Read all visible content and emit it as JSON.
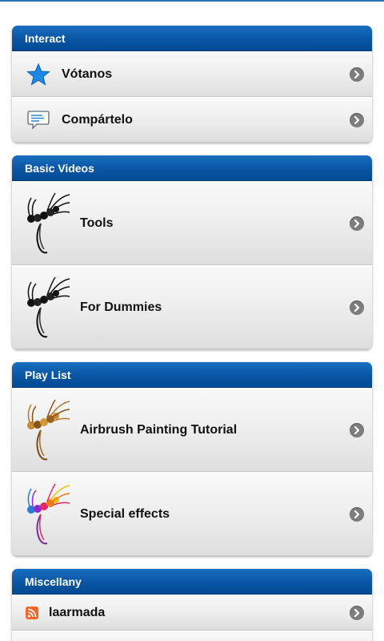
{
  "sections": {
    "interact": {
      "title": "Interact",
      "items": [
        {
          "label": "Vótanos",
          "icon": "star-icon"
        },
        {
          "label": "Compártelo",
          "icon": "speech-bubble-icon"
        }
      ]
    },
    "basic_videos": {
      "title": "Basic Videos",
      "items": [
        {
          "label": "Tools",
          "icon": "fairy-black-icon"
        },
        {
          "label": "For Dummies",
          "icon": "fairy-black-icon"
        }
      ]
    },
    "play_list": {
      "title": "Play List",
      "items": [
        {
          "label": "Airbrush Painting Tutorial",
          "icon": "fairy-gold-icon"
        },
        {
          "label": "Special effects",
          "icon": "fairy-rainbow-icon"
        }
      ]
    },
    "miscellany": {
      "title": "Miscellany",
      "items": [
        {
          "label": "laarmada",
          "icon": "rss-icon"
        }
      ]
    }
  },
  "colors": {
    "header_blue": "#0a57a6",
    "star_blue": "#1e88e5",
    "rss_orange": "#f26522"
  }
}
